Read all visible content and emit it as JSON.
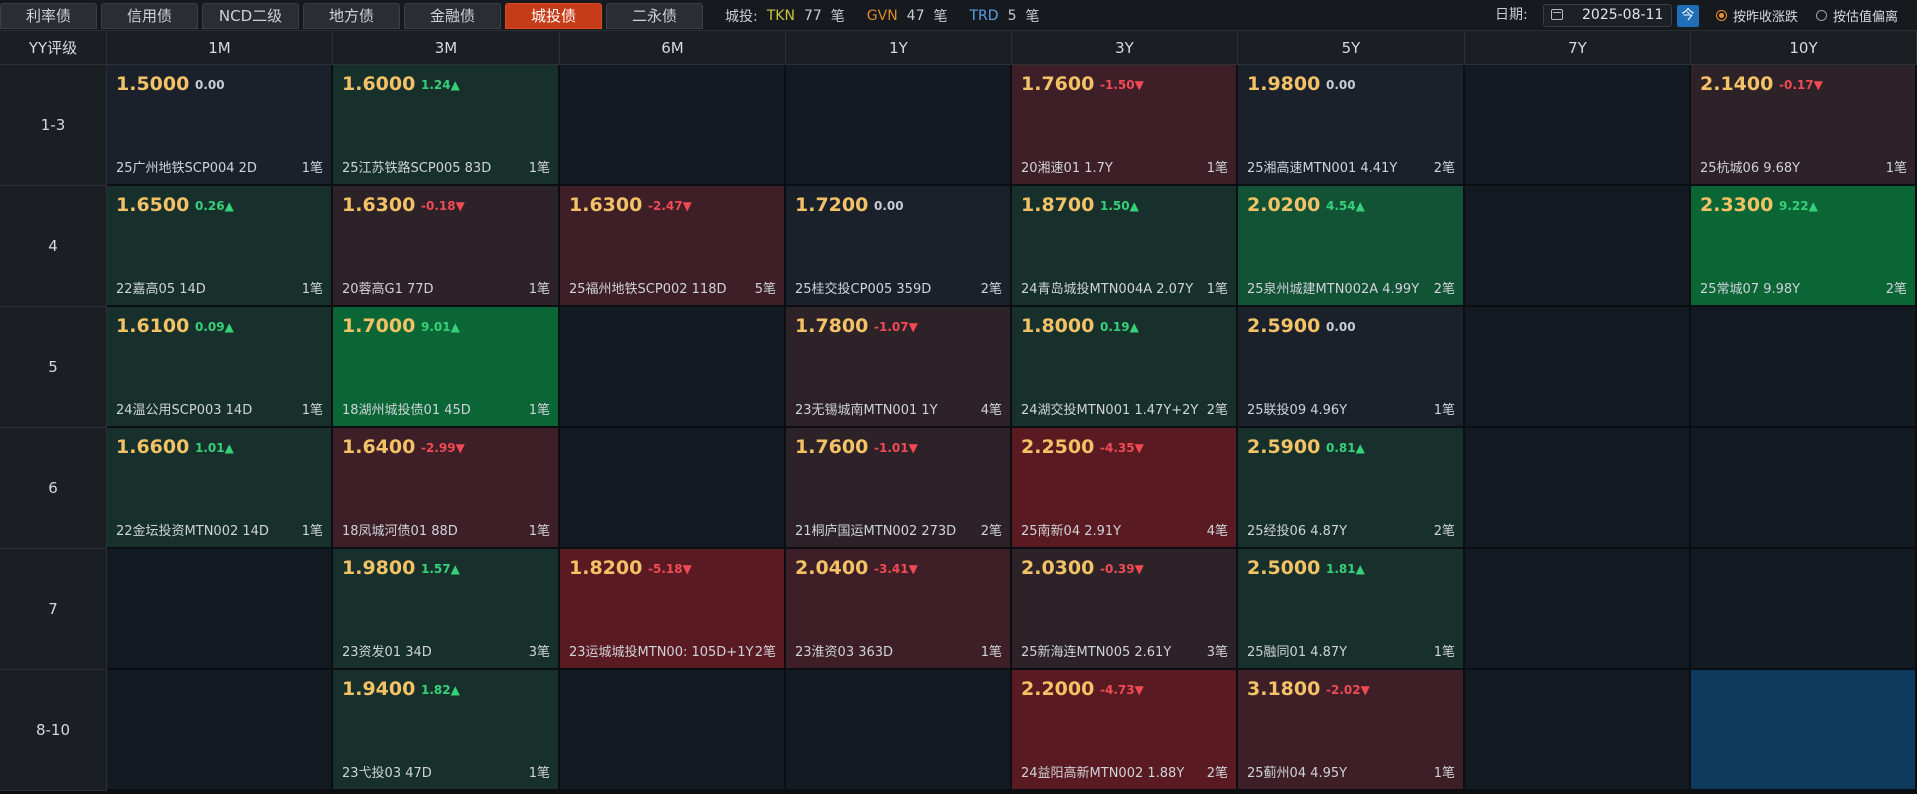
{
  "tabs": [
    "利率债",
    "信用债",
    "NCD二级",
    "地方债",
    "金融债",
    "城投债",
    "二永债"
  ],
  "active_tab_index": 5,
  "stats": {
    "label": "城投:",
    "tkn_label": "TKN",
    "tkn_count": "77",
    "tkn_unit": "笔",
    "gvn_label": "GVN",
    "gvn_count": "47",
    "gvn_unit": "笔",
    "trd_label": "TRD",
    "trd_count": "5",
    "trd_unit": "笔"
  },
  "date": {
    "label": "日期:",
    "value": "2025-08-11",
    "today_label": "今",
    "icon": "calendar-icon"
  },
  "options": [
    {
      "label": "按昨收涨跌",
      "selected": true
    },
    {
      "label": "按估值偏离",
      "selected": false
    }
  ],
  "colors": {
    "accent": "#c63b18",
    "price": "#f3c266",
    "up": "#37d07a",
    "down": "#f04a55",
    "radio_active": "#e8912d"
  },
  "grid": {
    "corner": "YY评级",
    "columns": [
      "1M",
      "3M",
      "6M",
      "1Y",
      "3Y",
      "5Y",
      "7Y",
      "10Y"
    ],
    "rows": [
      {
        "label": "1-3",
        "cells": [
          {
            "price": "1.5000",
            "change": "0.00",
            "dir": "flat",
            "tone": "flat",
            "name": "25广州地铁SCP004 2D",
            "count": "1笔"
          },
          {
            "price": "1.6000",
            "change": "1.24▲",
            "dir": "up",
            "tone": "g1",
            "name": "25江苏铁路SCP005 83D",
            "count": "1笔"
          },
          null,
          null,
          {
            "price": "1.7600",
            "change": "-1.50▼",
            "dir": "down",
            "tone": "r2",
            "name": "20湘速01 1.7Y",
            "count": "1笔"
          },
          {
            "price": "1.9800",
            "change": "0.00",
            "dir": "flat",
            "tone": "flat",
            "name": "25湘高速MTN001 4.41Y",
            "count": "2笔"
          },
          null,
          {
            "price": "2.1400",
            "change": "-0.17▼",
            "dir": "down",
            "tone": "r1",
            "name": "25杭城06 9.68Y",
            "count": "1笔"
          }
        ]
      },
      {
        "label": "4",
        "cells": [
          {
            "price": "1.6500",
            "change": "0.26▲",
            "dir": "up",
            "tone": "g1",
            "name": "22嘉高05 14D",
            "count": "1笔"
          },
          {
            "price": "1.6300",
            "change": "-0.18▼",
            "dir": "down",
            "tone": "r1",
            "name": "20蓉高G1 77D",
            "count": "1笔"
          },
          {
            "price": "1.6300",
            "change": "-2.47▼",
            "dir": "down",
            "tone": "r2",
            "name": "25福州地铁SCP002 118D",
            "count": "5笔"
          },
          {
            "price": "1.7200",
            "change": "0.00",
            "dir": "flat",
            "tone": "flat",
            "name": "25桂交投CP005 359D",
            "count": "2笔"
          },
          {
            "price": "1.8700",
            "change": "1.50▲",
            "dir": "up",
            "tone": "g1",
            "name": "24青岛城投MTN004A 2.07Y",
            "count": "1笔"
          },
          {
            "price": "2.0200",
            "change": "4.54▲",
            "dir": "up",
            "tone": "g2",
            "name": "25泉州城建MTN002A 4.99Y",
            "count": "2笔"
          },
          null,
          {
            "price": "2.3300",
            "change": "9.22▲",
            "dir": "up",
            "tone": "g3",
            "name": "25常城07 9.98Y",
            "count": "2笔"
          }
        ]
      },
      {
        "label": "5",
        "cells": [
          {
            "price": "1.6100",
            "change": "0.09▲",
            "dir": "up",
            "tone": "g1",
            "name": "24温公用SCP003 14D",
            "count": "1笔"
          },
          {
            "price": "1.7000",
            "change": "9.01▲",
            "dir": "up",
            "tone": "g3",
            "name": "18湖州城投债01 45D",
            "count": "1笔"
          },
          null,
          {
            "price": "1.7800",
            "change": "-1.07▼",
            "dir": "down",
            "tone": "r1",
            "name": "23无锡城南MTN001 1Y",
            "count": "4笔"
          },
          {
            "price": "1.8000",
            "change": "0.19▲",
            "dir": "up",
            "tone": "g1",
            "name": "24湖交投MTN001 1.47Y+2Y",
            "count": "2笔"
          },
          {
            "price": "2.5900",
            "change": "0.00",
            "dir": "flat",
            "tone": "flat",
            "name": "25联投09 4.96Y",
            "count": "1笔"
          },
          null,
          null
        ]
      },
      {
        "label": "6",
        "cells": [
          {
            "price": "1.6600",
            "change": "1.01▲",
            "dir": "up",
            "tone": "g1",
            "name": "22金坛投资MTN002 14D",
            "count": "1笔"
          },
          {
            "price": "1.6400",
            "change": "-2.99▼",
            "dir": "down",
            "tone": "r2",
            "name": "18凤城河债01 88D",
            "count": "1笔"
          },
          null,
          {
            "price": "1.7600",
            "change": "-1.01▼",
            "dir": "down",
            "tone": "r1",
            "name": "21桐庐国运MTN002 273D",
            "count": "2笔"
          },
          {
            "price": "2.2500",
            "change": "-4.35▼",
            "dir": "down",
            "tone": "r3",
            "name": "25南新04 2.91Y",
            "count": "4笔"
          },
          {
            "price": "2.5900",
            "change": "0.81▲",
            "dir": "up",
            "tone": "g1",
            "name": "25经投06 4.87Y",
            "count": "2笔"
          },
          null,
          null
        ]
      },
      {
        "label": "7",
        "cells": [
          null,
          {
            "price": "1.9800",
            "change": "1.57▲",
            "dir": "up",
            "tone": "g1",
            "name": "23资发01 34D",
            "count": "3笔"
          },
          {
            "price": "1.8200",
            "change": "-5.18▼",
            "dir": "down",
            "tone": "r3",
            "name": "23运城城投MTN00: 105D+1Y",
            "count": "2笔"
          },
          {
            "price": "2.0400",
            "change": "-3.41▼",
            "dir": "down",
            "tone": "r2",
            "name": "23淮资03 363D",
            "count": "1笔"
          },
          {
            "price": "2.0300",
            "change": "-0.39▼",
            "dir": "down",
            "tone": "r1",
            "name": "25新海连MTN005 2.61Y",
            "count": "3笔"
          },
          {
            "price": "2.5000",
            "change": "1.81▲",
            "dir": "up",
            "tone": "g1",
            "name": "25融同01 4.87Y",
            "count": "1笔"
          },
          null,
          null
        ]
      },
      {
        "label": "8-10",
        "cells": [
          null,
          {
            "price": "1.9400",
            "change": "1.82▲",
            "dir": "up",
            "tone": "g1",
            "name": "23弋投03 47D",
            "count": "1笔"
          },
          null,
          null,
          {
            "price": "2.2000",
            "change": "-4.73▼",
            "dir": "down",
            "tone": "r3",
            "name": "24益阳高新MTN002 1.88Y",
            "count": "2笔"
          },
          {
            "price": "3.1800",
            "change": "-2.02▼",
            "dir": "down",
            "tone": "r2",
            "name": "25蓟州04 4.95Y",
            "count": "1笔"
          },
          null,
          {
            "selected": true
          }
        ]
      }
    ]
  }
}
